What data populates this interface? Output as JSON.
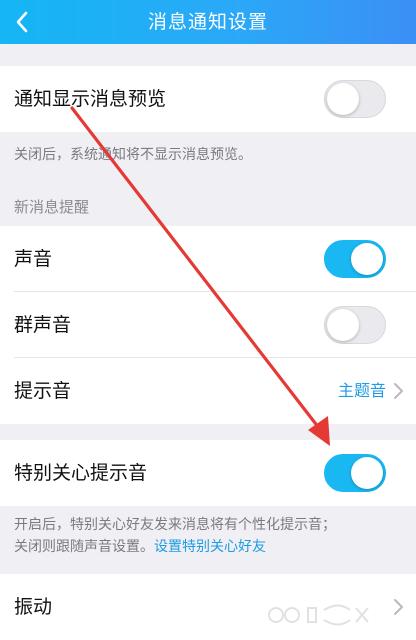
{
  "header": {
    "title": "消息通知设置",
    "back_icon": "chevron-left-icon"
  },
  "preview": {
    "label": "通知显示消息预览",
    "enabled": false,
    "note": "关闭后，系统通知将不显示消息预览。"
  },
  "section_new_message": {
    "title": "新消息提醒",
    "sound": {
      "label": "声音",
      "enabled": true
    },
    "group_sound": {
      "label": "群声音",
      "enabled": false
    },
    "tone": {
      "label": "提示音",
      "value": "主题音"
    }
  },
  "special_care": {
    "label": "特别关心提示音",
    "enabled": true,
    "note_line1": "开启后，特别关心好友发来消息将有个性化提示音；",
    "note_line2": "关闭则跟随声音设置。",
    "note_link": "设置特别关心好友"
  },
  "vibrate": {
    "label": "振动"
  },
  "colors": {
    "accent": "#19b8f2",
    "header_start": "#14b6f3",
    "header_end": "#3b8ff5",
    "link": "#1e9be6",
    "annotation_arrow": "#e53935"
  }
}
